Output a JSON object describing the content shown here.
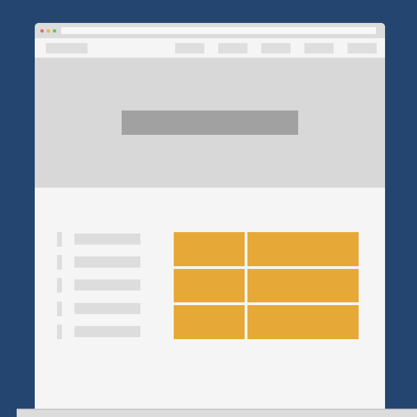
{
  "theme": {
    "background": "#24456f",
    "browser_frame": "#dcdcdc",
    "page_background": "#f5f5f5",
    "hero_background": "#d8d8d8",
    "hero_title_placeholder": "#a1a1a1",
    "placeholder": "#dddddd",
    "accent_tiles": "#e6a937"
  },
  "browser": {
    "window_controls": [
      {
        "name": "close",
        "color": "#ee6b5f"
      },
      {
        "name": "minimize",
        "color": "#f3b43f"
      },
      {
        "name": "maximize",
        "color": "#61c554"
      }
    ],
    "address_bar": ""
  },
  "navigation": {
    "logo": "",
    "links": [
      "",
      "",
      "",
      "",
      ""
    ]
  },
  "hero": {
    "title": ""
  },
  "content": {
    "list_items": [
      "",
      "",
      "",
      "",
      ""
    ],
    "grid_tiles": [
      "",
      "",
      "",
      "",
      "",
      ""
    ]
  }
}
